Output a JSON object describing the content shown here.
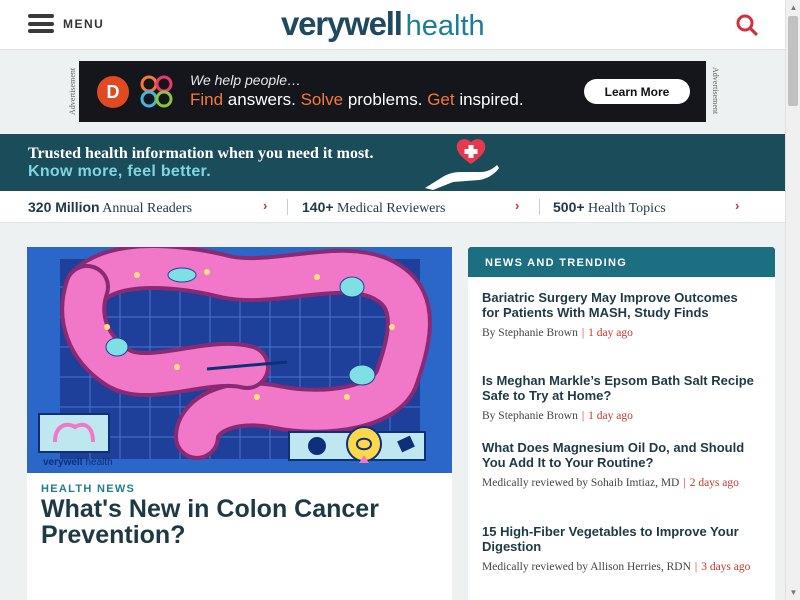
{
  "header": {
    "menu_label": "MENU",
    "logo_primary": "verywell",
    "logo_secondary": "health"
  },
  "ad": {
    "label": "Advertisement",
    "brand_letter": "D",
    "headline": "We help people…",
    "tagline_1": "Find",
    "tagline_2": " answers. ",
    "tagline_3": "Solve",
    "tagline_4": " problems. ",
    "tagline_5": "Get",
    "tagline_6": " inspired.",
    "cta": "Learn More"
  },
  "promo": {
    "line1": "Trusted health information when you need it most.",
    "line2": "Know more, feel better."
  },
  "stats": [
    {
      "bold": "320 Million",
      "text": " Annual Readers"
    },
    {
      "bold": "140+",
      "text": " Medical Reviewers"
    },
    {
      "bold": "500+",
      "text": " Health Topics"
    }
  ],
  "feature": {
    "kicker": "HEALTH NEWS",
    "title": "What's New in Colon Cancer Prevention?",
    "image_watermark_1": "verywell",
    "image_watermark_2": "health"
  },
  "news": {
    "heading": "NEWS AND TRENDING",
    "items": [
      {
        "title": "Bariatric Surgery May Improve Outcomes for Patients With MASH, Study Finds",
        "byline": "By Stephanie Brown",
        "date": "1 day ago"
      },
      {
        "title": "Is Meghan Markle’s Epsom Bath Salt Recipe Safe to Try at Home?",
        "byline": "By Stephanie Brown",
        "date": "1 day ago"
      },
      {
        "title": "What Does Magnesium Oil Do, and Should You Add It to Your Routine?",
        "byline": "Medically reviewed by Sohaib Imtiaz, MD",
        "date": "2 days ago"
      },
      {
        "title": "15 High-Fiber Vegetables to Improve Your Digestion",
        "byline": "Medically reviewed by Allison Herries, RDN",
        "date": "3 days ago"
      }
    ]
  },
  "colors": {
    "brand_dark": "#1d4a5e",
    "brand_teal": "#1b6f80",
    "accent_red": "#d1313b",
    "ad_orange": "#f3793b"
  },
  "icons": {
    "menu": "hamburger-icon",
    "search": "search-icon",
    "stat_arrow": "chevron-right-icon"
  }
}
